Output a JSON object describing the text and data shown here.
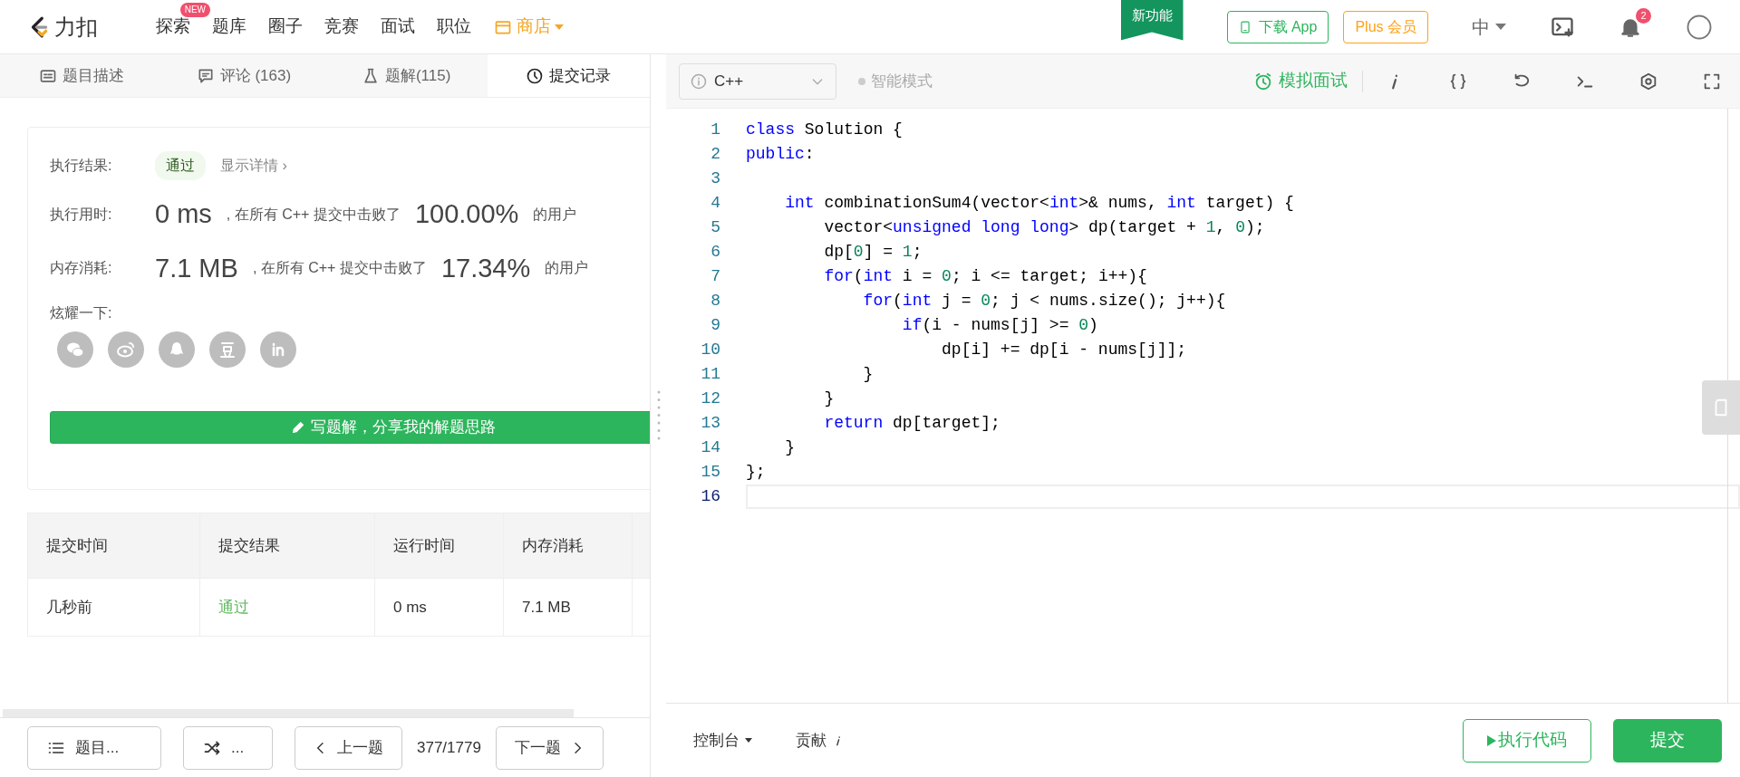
{
  "nav": {
    "brand": "力扣",
    "items": [
      {
        "label": "探索",
        "kind": "link",
        "badge": "NEW"
      },
      {
        "label": "题库",
        "kind": "link"
      },
      {
        "label": "圈子",
        "kind": "link"
      },
      {
        "label": "竞赛",
        "kind": "link"
      },
      {
        "label": "面试",
        "kind": "link"
      },
      {
        "label": "职位",
        "kind": "link"
      },
      {
        "label": "商店",
        "kind": "store"
      }
    ],
    "ribbon": "新功能",
    "download": "下载 App",
    "plus": "Plus 会员",
    "language": "中",
    "notifications": "2"
  },
  "tabs": [
    {
      "label": "题目描述",
      "selected": false
    },
    {
      "label": "评论 (163)",
      "selected": false
    },
    {
      "label": "题解(115)",
      "selected": false
    },
    {
      "label": "提交记录",
      "selected": true
    }
  ],
  "result": {
    "rows": [
      {
        "kind": "status",
        "label": "执行结果:",
        "badge": "通过",
        "link": "显示详情 ›"
      },
      {
        "kind": "stat",
        "label": "执行用时:",
        "value": "0 ms",
        "text": ", 在所有 C++ 提交中击败了",
        "percent": "100.00%",
        "suffix": "的用户"
      },
      {
        "kind": "stat",
        "label": "内存消耗:",
        "value": "7.1 MB",
        "text": ", 在所有 C++ 提交中击败了",
        "percent": "17.34%",
        "suffix": "的用户"
      }
    ],
    "share_label": "炫耀一下:",
    "write_button": "写题解，分享我的解题思路"
  },
  "table": {
    "columns": [
      "提交时间",
      "提交结果",
      "运行时间",
      "内存消耗"
    ],
    "rows": [
      {
        "cells": [
          "几秒前",
          "通过",
          "0 ms",
          "7.1 MB"
        ]
      }
    ]
  },
  "bottom_left": {
    "list_button": "题目...",
    "random_button": "...",
    "prev": "上一题",
    "counter": "377/1779",
    "next": "下一题"
  },
  "editor": {
    "language": "C++",
    "smart_mode": "智能模式",
    "interview": "模拟面试",
    "lines": [
      {
        "number": "1",
        "active": false,
        "tokens": [
          {
            "kind": "keyword",
            "text": "class"
          },
          {
            "kind": "plain",
            "text": " Solution {"
          }
        ]
      },
      {
        "number": "2",
        "active": false,
        "tokens": [
          {
            "kind": "keyword",
            "text": "public"
          },
          {
            "kind": "plain",
            "text": ":"
          }
        ]
      },
      {
        "number": "3",
        "active": false
      },
      {
        "number": "4",
        "active": false,
        "tokens": [
          {
            "kind": "keyword",
            "text": "    int"
          },
          {
            "kind": "plain",
            "text": " combinationSum4(vector<"
          },
          {
            "kind": "keyword",
            "text": "int"
          },
          {
            "kind": "plain",
            "text": ">& nums, "
          },
          {
            "kind": "keyword",
            "text": "int"
          },
          {
            "kind": "plain",
            "text": " target) {"
          }
        ]
      },
      {
        "number": "5",
        "active": false,
        "tokens": [
          {
            "kind": "plain",
            "text": "        vector<"
          },
          {
            "kind": "keyword",
            "text": "unsigned long long"
          },
          {
            "kind": "plain",
            "text": "> dp(target + "
          },
          {
            "kind": "number",
            "text": "1"
          },
          {
            "kind": "plain",
            "text": ", "
          },
          {
            "kind": "number",
            "text": "0"
          },
          {
            "kind": "plain",
            "text": ");"
          }
        ]
      },
      {
        "number": "6",
        "active": false,
        "tokens": [
          {
            "kind": "plain",
            "text": "        dp["
          },
          {
            "kind": "number",
            "text": "0"
          },
          {
            "kind": "plain",
            "text": "] = "
          },
          {
            "kind": "number",
            "text": "1"
          },
          {
            "kind": "plain",
            "text": ";"
          }
        ]
      },
      {
        "number": "7",
        "active": false,
        "tokens": [
          {
            "kind": "keyword",
            "text": "        for"
          },
          {
            "kind": "plain",
            "text": "("
          },
          {
            "kind": "keyword",
            "text": "int"
          },
          {
            "kind": "plain",
            "text": " i = "
          },
          {
            "kind": "number",
            "text": "0"
          },
          {
            "kind": "plain",
            "text": "; i <= target; i++){"
          }
        ]
      },
      {
        "number": "8",
        "active": false,
        "tokens": [
          {
            "kind": "keyword",
            "text": "            for"
          },
          {
            "kind": "plain",
            "text": "("
          },
          {
            "kind": "keyword",
            "text": "int"
          },
          {
            "kind": "plain",
            "text": " j = "
          },
          {
            "kind": "number",
            "text": "0"
          },
          {
            "kind": "plain",
            "text": "; j < nums.size(); j++){"
          }
        ]
      },
      {
        "number": "9",
        "active": false,
        "tokens": [
          {
            "kind": "keyword",
            "text": "                if"
          },
          {
            "kind": "plain",
            "text": "(i - nums[j] >= "
          },
          {
            "kind": "number",
            "text": "0"
          },
          {
            "kind": "plain",
            "text": ")"
          }
        ]
      },
      {
        "number": "10",
        "active": false,
        "tokens": [
          {
            "kind": "plain",
            "text": "                    dp[i] += dp[i - nums[j]];"
          }
        ]
      },
      {
        "number": "11",
        "active": false,
        "tokens": [
          {
            "kind": "plain",
            "text": "            }"
          }
        ]
      },
      {
        "number": "12",
        "active": false,
        "tokens": [
          {
            "kind": "plain",
            "text": "        }"
          }
        ]
      },
      {
        "number": "13",
        "active": false,
        "tokens": [
          {
            "kind": "keyword",
            "text": "        return"
          },
          {
            "kind": "plain",
            "text": " dp[target];"
          }
        ]
      },
      {
        "number": "14",
        "active": false,
        "tokens": [
          {
            "kind": "plain",
            "text": "    }"
          }
        ]
      },
      {
        "number": "15",
        "active": false,
        "tokens": [
          {
            "kind": "plain",
            "text": "};"
          }
        ]
      },
      {
        "number": "16",
        "active": true
      }
    ]
  },
  "bottom_right": {
    "console": "控制台",
    "contribute": "贡献",
    "run": "执行代码",
    "submit": "提交"
  }
}
